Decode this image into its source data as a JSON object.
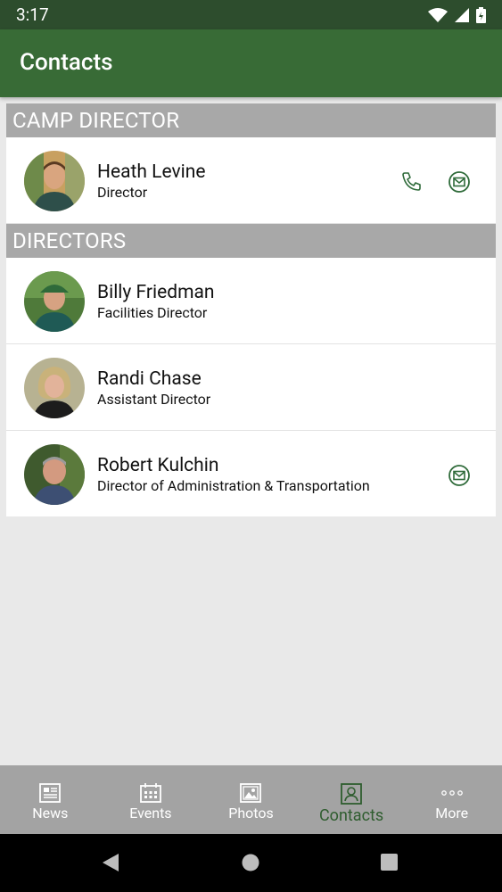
{
  "status": {
    "time": "3:17"
  },
  "appbar": {
    "title": "Contacts"
  },
  "sections": [
    {
      "header": "CAMP DIRECTOR",
      "contacts": [
        {
          "name": "Heath Levine",
          "role": "Director",
          "phone": true,
          "email": true
        }
      ]
    },
    {
      "header": "DIRECTORS",
      "contacts": [
        {
          "name": "Billy Friedman",
          "role": "Facilities Director",
          "phone": false,
          "email": false
        },
        {
          "name": "Randi Chase",
          "role": "Assistant Director",
          "phone": false,
          "email": false
        },
        {
          "name": "Robert Kulchin",
          "role": "Director of Administration & Transportation",
          "phone": false,
          "email": true
        }
      ]
    }
  ],
  "nav": {
    "items": [
      {
        "label": "News",
        "icon": "news-icon"
      },
      {
        "label": "Events",
        "icon": "calendar-icon"
      },
      {
        "label": "Photos",
        "icon": "photos-icon"
      },
      {
        "label": "Contacts",
        "icon": "contacts-icon",
        "active": true
      },
      {
        "label": "More",
        "icon": "more-icon"
      }
    ]
  },
  "colors": {
    "appbar": "#386b36",
    "statusbar": "#2d4d2d",
    "section_header": "#a8a8a8",
    "icon_green": "#2f6b3a",
    "nav_bg": "#a3a3a3"
  }
}
